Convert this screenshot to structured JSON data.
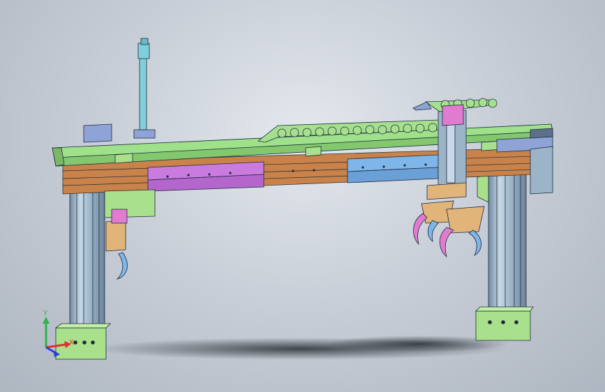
{
  "viewport": {
    "background_top": "#e4e8ee",
    "background_bottom": "#aeb6c1"
  },
  "model": {
    "part_colors": {
      "beam": "#9fe08a",
      "rail_brown": "#c8824a",
      "carriage_purple": "#c97be0",
      "carriage_blue": "#7fb6ea",
      "column_steel": "#9bb4c8",
      "foot": "#a9e08b",
      "cylinder": "#7fd0dc",
      "gripper_tan": "#e1b47a",
      "gripper_pink": "#e07bd0",
      "motor": "#8fa3d6",
      "drag_chain": "#a6e08f",
      "outline": "#1c2a3a"
    }
  },
  "triad": {
    "x_label": "X",
    "y_label": "Y",
    "x_color": "#e03030",
    "y_color": "#2fb34a",
    "z_color": "#2a3fd8"
  }
}
